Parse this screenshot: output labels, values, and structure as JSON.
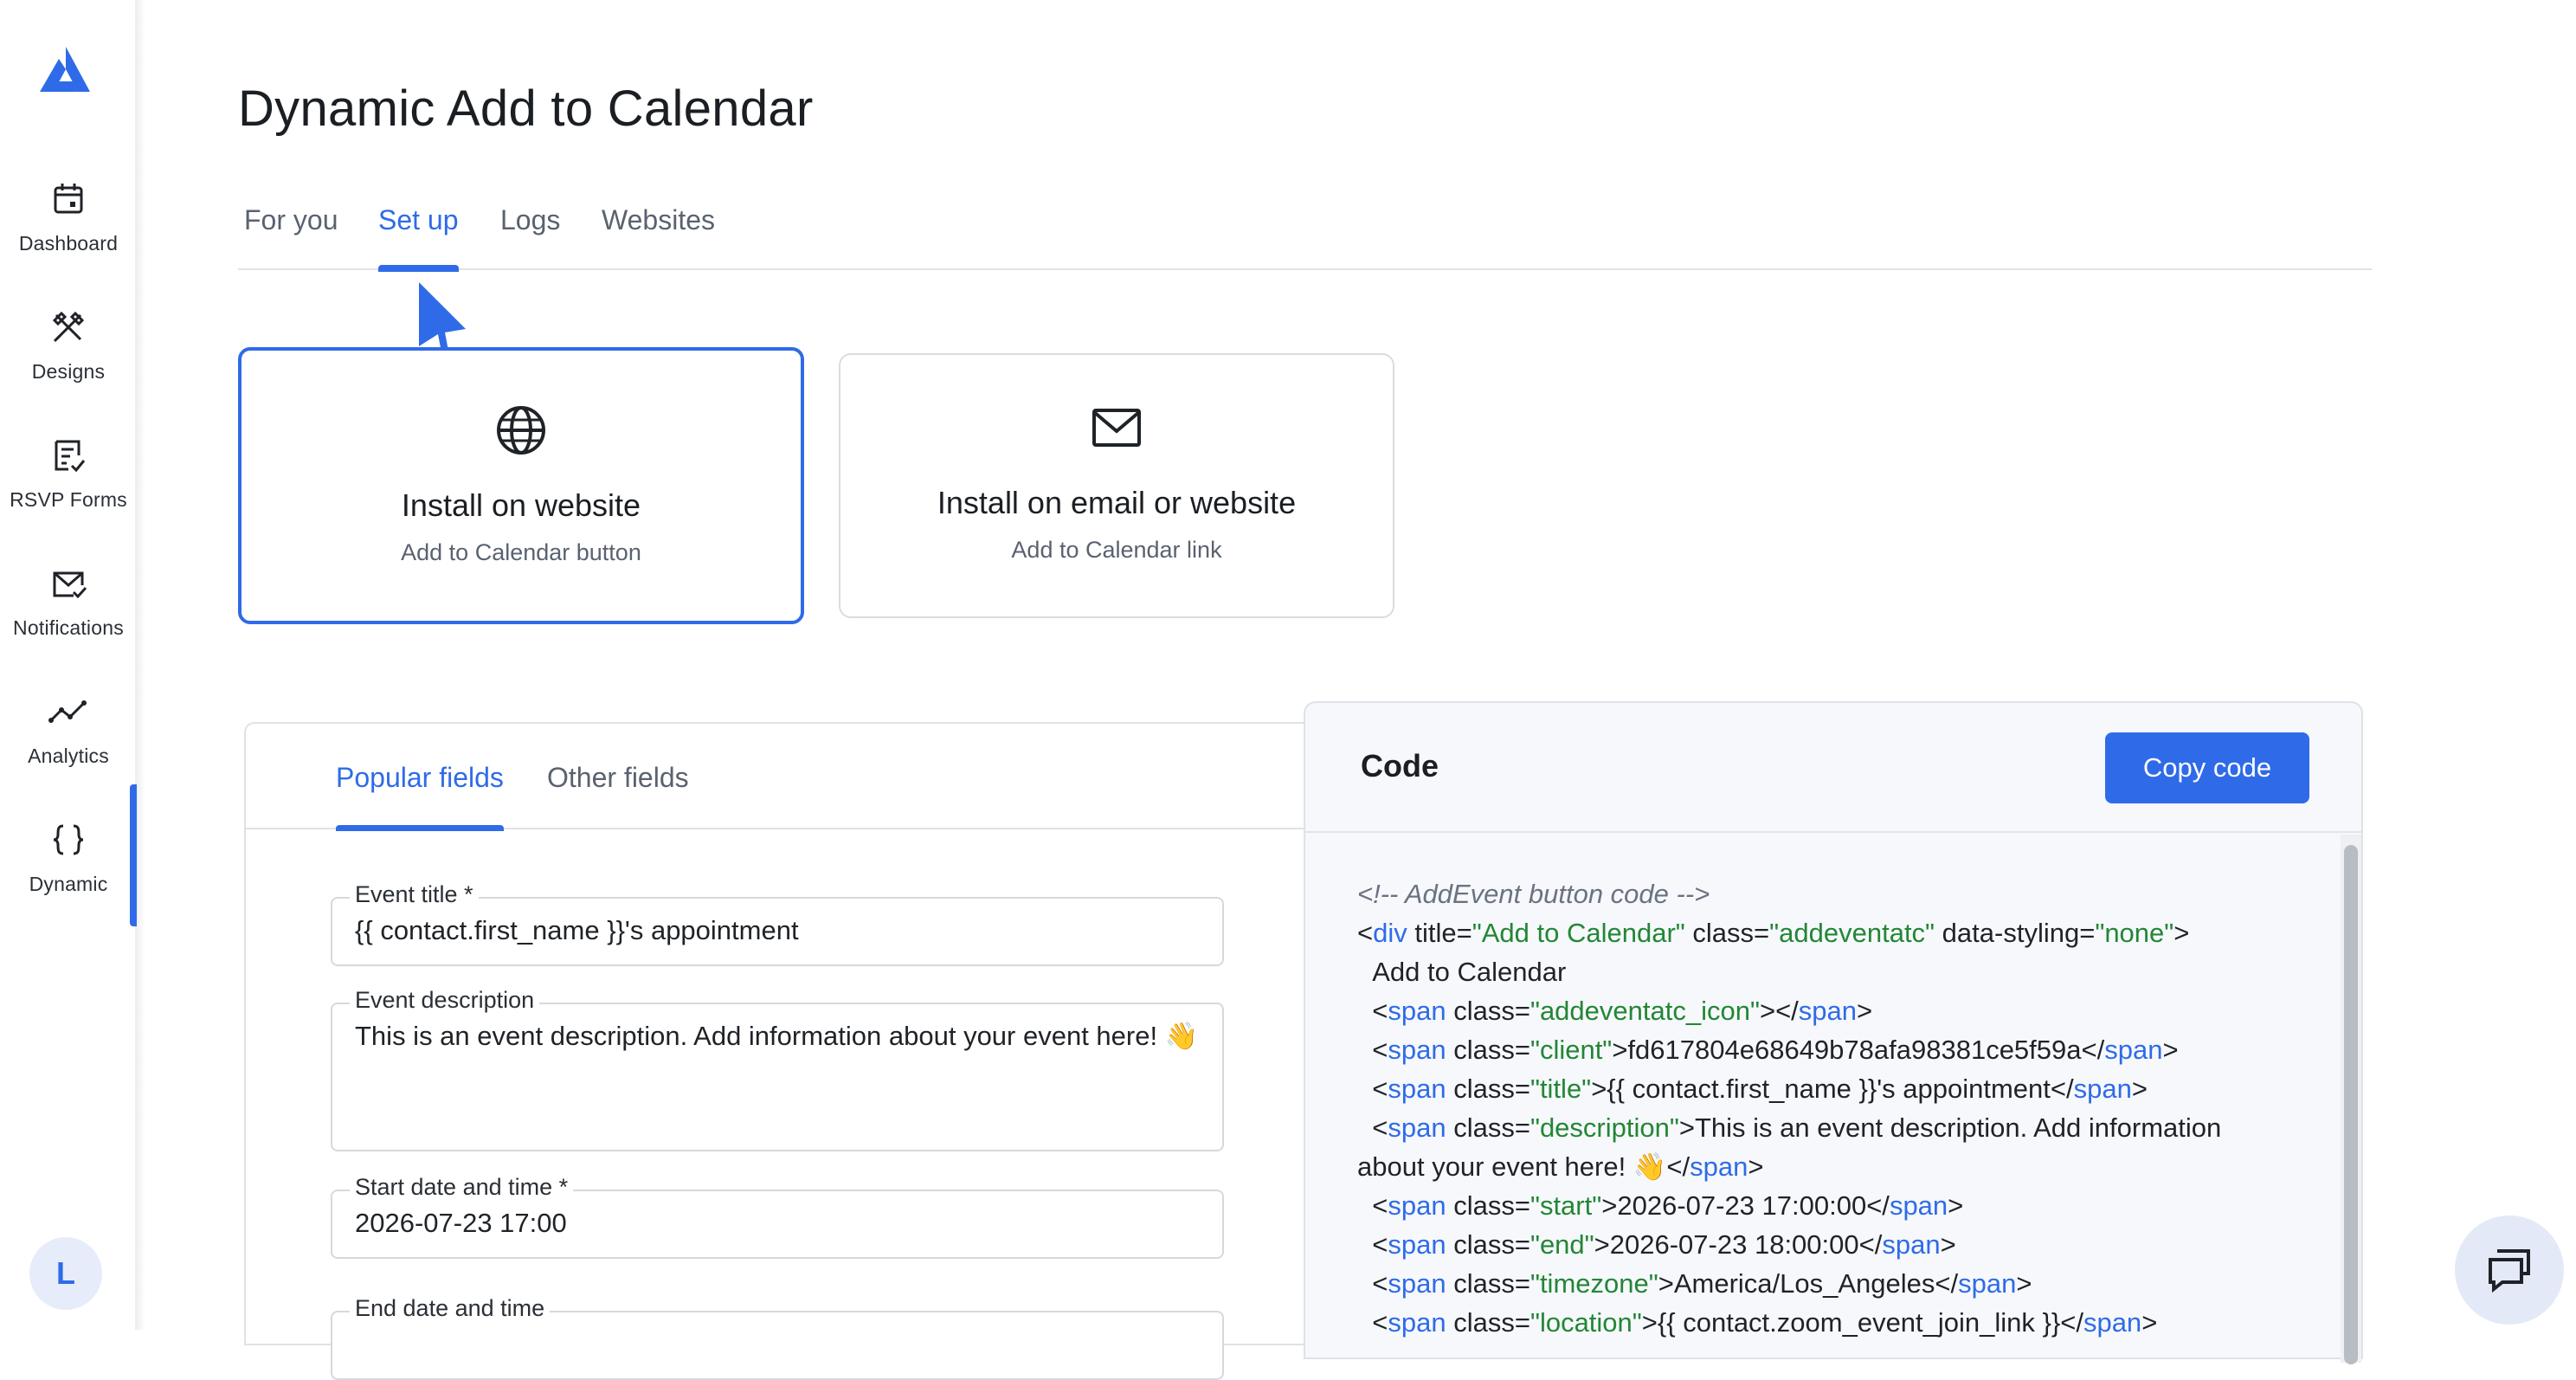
{
  "app": {
    "title": "Dynamic Add to Calendar"
  },
  "sidebar": {
    "items": [
      {
        "label": "Dashboard",
        "icon": "calendar-icon"
      },
      {
        "label": "Designs",
        "icon": "design-tools-icon"
      },
      {
        "label": "RSVP Forms",
        "icon": "form-checklist-icon"
      },
      {
        "label": "Notifications",
        "icon": "mail-check-icon"
      },
      {
        "label": "Analytics",
        "icon": "line-chart-icon"
      },
      {
        "label": "Dynamic",
        "icon": "curly-braces-icon"
      }
    ],
    "active": "Dynamic",
    "avatar_initial": "L"
  },
  "tabs": [
    {
      "label": "For you"
    },
    {
      "label": "Set up"
    },
    {
      "label": "Logs"
    },
    {
      "label": "Websites"
    }
  ],
  "active_tab": "Set up",
  "install_options": [
    {
      "title": "Install on website",
      "subtitle": "Add to Calendar button",
      "icon": "globe-icon",
      "selected": true
    },
    {
      "title": "Install on email or website",
      "subtitle": "Add to Calendar link",
      "icon": "envelope-icon",
      "selected": false
    }
  ],
  "field_tabs": [
    {
      "label": "Popular fields"
    },
    {
      "label": "Other fields"
    }
  ],
  "active_field_tab": "Popular fields",
  "fields": {
    "event_title": {
      "label": "Event title *",
      "value": "{{ contact.first_name }}'s appointment"
    },
    "event_description": {
      "label": "Event description",
      "value": "This is an event description. Add information about your event here! 👋"
    },
    "start": {
      "label": "Start date and time *",
      "value": "2026-07-23 17:00"
    },
    "end": {
      "label": "End date and time",
      "value": ""
    }
  },
  "code": {
    "title": "Code",
    "copy_label": "Copy code",
    "lines": [
      "<!-- AddEvent button code -->",
      "<div title=\"Add to Calendar\" class=\"addeventatc\" data-styling=\"none\">",
      "  Add to Calendar",
      "  <span class=\"addeventatc_icon\"></span>",
      "  <span class=\"client\">fd617804e68649b78afa98381ce5f59a</span>",
      "  <span class=\"title\">{{ contact.first_name }}'s appointment</span>",
      "  <span class=\"description\">This is an event description. Add information about your event here! 👋</span>",
      "  <span class=\"start\">2026-07-23 17:00:00</span>",
      "  <span class=\"end\">2026-07-23 18:00:00</span>",
      "  <span class=\"timezone\">America/Los_Angeles</span>",
      "  <span class=\"location\">{{ contact.zoom_event_join_link }}</span>"
    ]
  },
  "colors": {
    "accent": "#2f6be8",
    "string": "#238636",
    "comment": "#6b7280"
  }
}
